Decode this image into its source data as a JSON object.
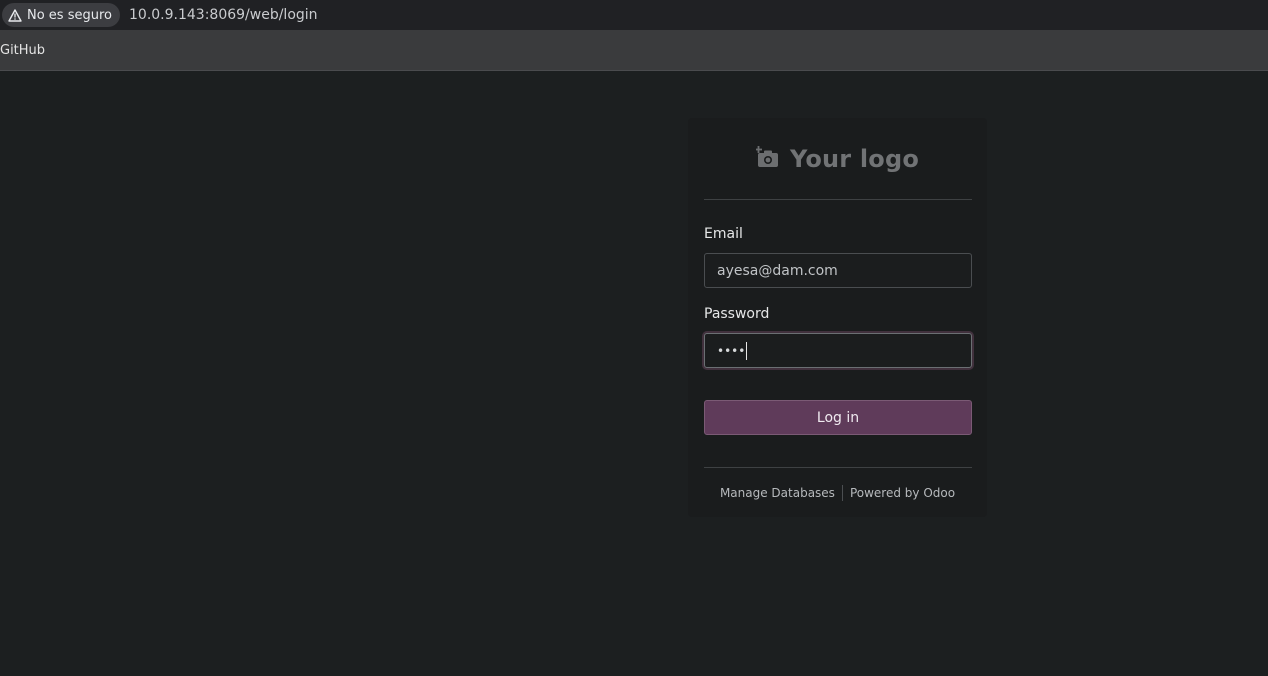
{
  "browser": {
    "security_label": "No es seguro",
    "url": "10.0.9.143:8069/web/login",
    "bookmarks": [
      {
        "label": "GitHub"
      }
    ]
  },
  "login": {
    "logo_text": "Your logo",
    "email_label": "Email",
    "email_value": "ayesa@dam.com",
    "password_label": "Password",
    "password_masked": "••••",
    "submit_label": "Log in",
    "footer": {
      "manage_label": "Manage Databases",
      "powered_prefix": "Powered by ",
      "powered_brand": "Odoo"
    }
  },
  "icons": {
    "warning": "warning-triangle-icon",
    "logo": "camera-plus-icon"
  },
  "colors": {
    "page_bg": "#1c1f20",
    "primary_button": "#5f3b5a"
  }
}
